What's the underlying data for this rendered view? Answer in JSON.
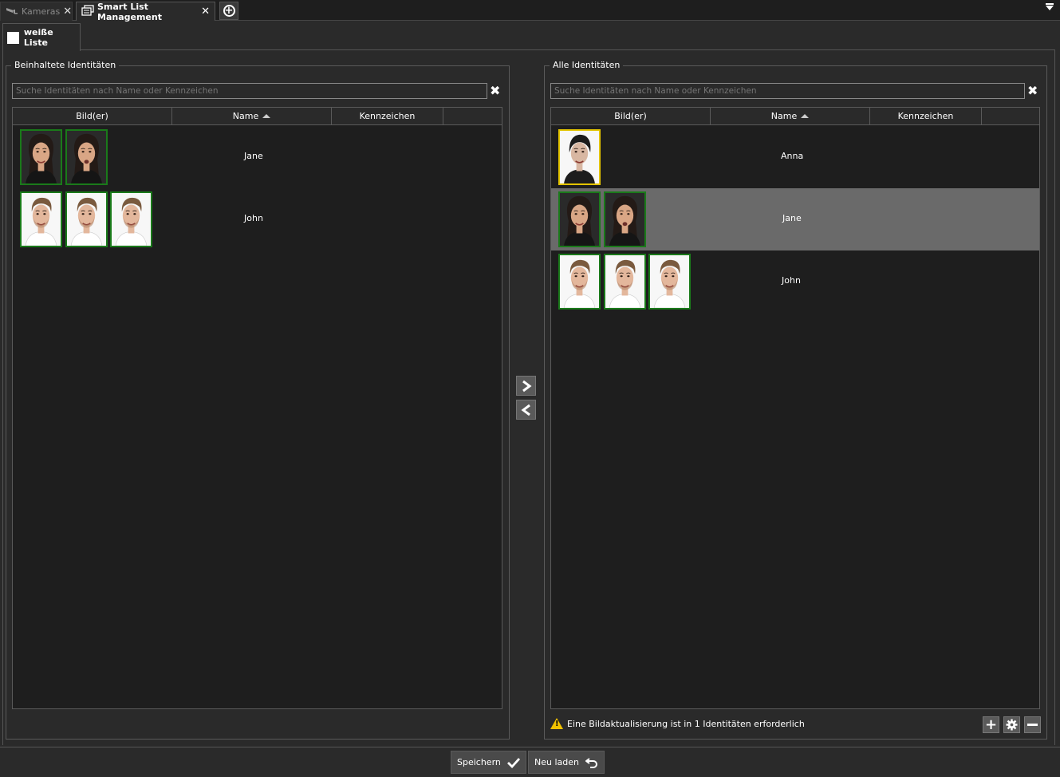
{
  "tabs": [
    {
      "label": "Kameras",
      "icon": "camera-icon",
      "active": false
    },
    {
      "label": "Smart List Management",
      "icon": "list-management-icon",
      "active": true
    }
  ],
  "subtab": {
    "label": "weiße Liste"
  },
  "left_panel": {
    "title": "Beinhaltete Identitäten",
    "search_placeholder": "Suche Identitäten nach Name oder Kennzeichen",
    "columns": [
      "Bild(er)",
      "Name",
      "Kennzeichen"
    ],
    "rows": [
      {
        "name": "Jane",
        "images": 2,
        "person": "female"
      },
      {
        "name": "John",
        "images": 3,
        "person": "male"
      }
    ]
  },
  "right_panel": {
    "title": "Alle Identitäten",
    "search_placeholder": "Suche Identitäten nach Name oder Kennzeichen",
    "columns": [
      "Bild(er)",
      "Name",
      "Kennzeichen"
    ],
    "rows": [
      {
        "name": "Anna",
        "images": 1,
        "person": "anna",
        "selected": false
      },
      {
        "name": "Jane",
        "images": 2,
        "person": "female",
        "selected": true
      },
      {
        "name": "John",
        "images": 3,
        "person": "male",
        "selected": false
      }
    ],
    "notice": "Eine Bildaktualisierung ist in 1 Identitäten erforderlich"
  },
  "actions": {
    "save_label": "Speichern",
    "reload_label": "Neu laden"
  },
  "colors": {
    "background": "#2a2a2a",
    "table_bg": "#1e1e1e",
    "thumb_ok_border": "#1a7a1a",
    "thumb_warn_border": "#e3c400",
    "selected_row": "#6a6a6a",
    "warning": "#f2c200"
  }
}
